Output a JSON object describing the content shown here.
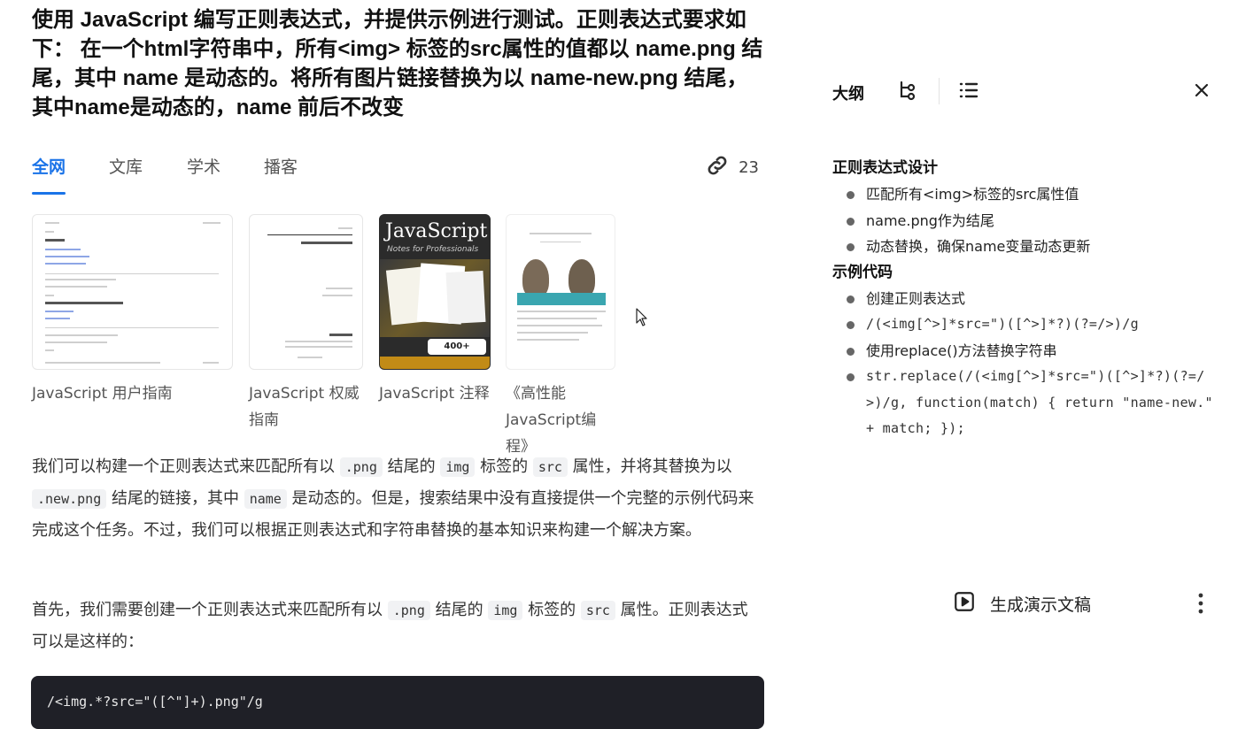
{
  "question": "使用 JavaScript 编写正则表达式，并提供示例进行测试。正则表达式要求如下： 在一个html字符串中，所有<img> 标签的src属性的值都以 name.png 结尾，其中 name 是动态的。将所有图片链接替换为以 name-new.png 结尾，其中name是动态的，name 前后不改变",
  "tabs": [
    "全网",
    "文库",
    "学术",
    "播客"
  ],
  "source_count": "23",
  "cards": [
    {
      "title": "JavaScript 用户指南"
    },
    {
      "title": "JavaScript 权威指南"
    },
    {
      "title": "JavaScript 注释"
    },
    {
      "title": "《高性能JavaScript编程》"
    }
  ],
  "book_cover": {
    "name": "JavaScript",
    "subtitle": "Notes for Professionals",
    "badge": "400+ pages"
  },
  "para1": {
    "t1": "我们可以构建一个正则表达式来匹配所有以 ",
    "c1": ".png",
    "t2": " 结尾的 ",
    "c2": "img",
    "t3": " 标签的 ",
    "c3": "src",
    "t4": " 属性，并将其替换为以 ",
    "c4": ".new.png",
    "t5": " 结尾的链接，其中 ",
    "c5": "name",
    "t6": " 是动态的。但是，搜索结果中没有直接提供一个完整的示例代码来完成这个任务。不过，我们可以根据正则表达式和字符串替换的基本知识来构建一个解决方案。"
  },
  "para2": {
    "t1": "首先，我们需要创建一个正则表达式来匹配所有以 ",
    "c1": ".png",
    "t2": " 结尾的 ",
    "c2": "img",
    "t3": " 标签的 ",
    "c3": "src",
    "t4": " 属性。正则表达式可以是这样的："
  },
  "code_block": "/<img.*?src=\"([^\"]+).png\"/g",
  "sidebar": {
    "outline_label": "大纲",
    "sections": [
      {
        "title": "正则表达式设计",
        "items": [
          "匹配所有<img>标签的src属性值",
          "name.png作为结尾",
          "动态替换，确保name变量动态更新"
        ]
      },
      {
        "title": "示例代码",
        "items": [
          "创建正则表达式",
          "/(<img[^>]*src=\")([^>]*?)(?=/>)/g",
          "使用replace()方法替换字符串",
          "str.replace(/(<img[^>]*src=\")([^>]*?)(?=/>)/g, function(match) { return \"name-new.\" + match; });"
        ]
      }
    ],
    "generate_label": "生成演示文稿"
  },
  "colors": {
    "accent": "#1a73e8",
    "code_bg": "#1f2027"
  }
}
